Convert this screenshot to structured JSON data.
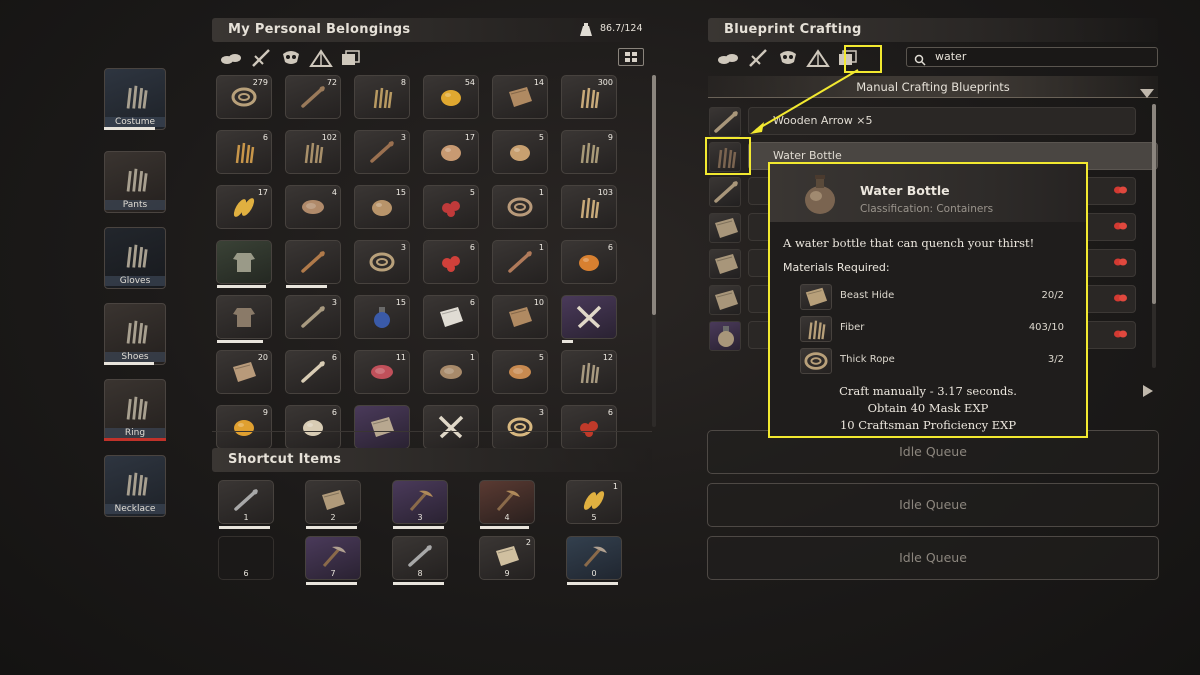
{
  "equipment": [
    {
      "label": "Costume",
      "icon": "costume-icon",
      "durability": 0.82,
      "dur_color": "#e8e4dc"
    },
    {
      "label": "Pants",
      "icon": "pants-icon",
      "durability": 0,
      "dur_color": "#e8e4dc"
    },
    {
      "label": "Gloves",
      "icon": "gloves-icon",
      "durability": 0,
      "dur_color": "#e8e4dc"
    },
    {
      "label": "Shoes",
      "icon": "shoes-icon",
      "durability": 0.8,
      "dur_color": "#e8e4dc"
    },
    {
      "label": "Ring",
      "icon": "ring-icon",
      "durability": 1.0,
      "dur_color": "#c0322a"
    },
    {
      "label": "Necklace",
      "icon": "necklace-icon",
      "durability": 0,
      "dur_color": "#e8e4dc"
    }
  ],
  "inventory": {
    "title": "My Personal Belongings",
    "weight": "86.7/124",
    "weight_icon": "weight-icon",
    "filter_icons": [
      "resources-icon",
      "weapons-icon",
      "armor-icon",
      "camp-icon",
      "all-items-icon"
    ],
    "layout_icon": "grid-layout-icon",
    "items": [
      {
        "icon": "rope-coil-icon",
        "qty": "279",
        "tone": "",
        "color": "#b8a07a",
        "durability": null
      },
      {
        "icon": "branch-icon",
        "qty": "72",
        "tone": "",
        "color": "#9a7a5a",
        "durability": null
      },
      {
        "icon": "grass-bundle-icon",
        "qty": "8",
        "tone": "",
        "color": "#b89a62",
        "durability": null
      },
      {
        "icon": "resin-icon",
        "qty": "54",
        "tone": "",
        "color": "#e0a830",
        "durability": null
      },
      {
        "icon": "wood-plank-icon",
        "qty": "14",
        "tone": "",
        "color": "#b08a62",
        "durability": null
      },
      {
        "icon": "fiber-bundle-icon",
        "qty": "300",
        "tone": "",
        "color": "#c8aa7a",
        "durability": null
      },
      {
        "icon": "seeds-icon",
        "qty": "6",
        "tone": "",
        "color": "#c8964a",
        "durability": null
      },
      {
        "icon": "hay-bundle-icon",
        "qty": "102",
        "tone": "",
        "color": "#a8906a",
        "durability": null
      },
      {
        "icon": "spear-icon",
        "qty": "3",
        "tone": "",
        "color": "#9a7050",
        "durability": null
      },
      {
        "icon": "mushroom-icon",
        "qty": "17",
        "tone": "",
        "color": "#c89a72",
        "durability": null
      },
      {
        "icon": "potato-icon",
        "qty": "5",
        "tone": "",
        "color": "#c8a070",
        "durability": null
      },
      {
        "icon": "herb-icon",
        "qty": "9",
        "tone": "",
        "color": "#a89a78",
        "durability": null
      },
      {
        "icon": "corn-icon",
        "qty": "17",
        "tone": "",
        "color": "#e0b040",
        "durability": null
      },
      {
        "icon": "meat-jerky-icon",
        "qty": "4",
        "tone": "",
        "color": "#b08a6a",
        "durability": null
      },
      {
        "icon": "nuts-icon",
        "qty": "15",
        "tone": "",
        "color": "#b8946a",
        "durability": null
      },
      {
        "icon": "berries-icon",
        "qty": "5",
        "tone": "",
        "color": "#c03a3a",
        "durability": null
      },
      {
        "icon": "clay-disc-icon",
        "qty": "1",
        "tone": "",
        "color": "#b89a7a",
        "durability": null
      },
      {
        "icon": "fiber-bundle-icon",
        "qty": "103",
        "tone": "",
        "color": "#c8aa7a",
        "durability": null
      },
      {
        "icon": "cloth-shirt-icon",
        "qty": "",
        "tone": "green",
        "color": "#9a9a88",
        "durability": 0.9
      },
      {
        "icon": "torch-icon",
        "qty": "",
        "tone": "",
        "color": "#b07a4a",
        "durability": 0.75
      },
      {
        "icon": "rope-coil-icon",
        "qty": "3",
        "tone": "",
        "color": "#b8a07a",
        "durability": null
      },
      {
        "icon": "strawberry-icon",
        "qty": "6",
        "tone": "",
        "color": "#d0403a",
        "durability": null
      },
      {
        "icon": "bone-icon",
        "qty": "1",
        "tone": "",
        "color": "#b07a5a",
        "durability": null
      },
      {
        "icon": "pumpkin-icon",
        "qty": "6",
        "tone": "",
        "color": "#d88030",
        "durability": null
      },
      {
        "icon": "leather-skirt-icon",
        "qty": "",
        "tone": "",
        "color": "#8a7a68",
        "durability": 0.85
      },
      {
        "icon": "twigs-icon",
        "qty": "3",
        "tone": "",
        "color": "#a89a80",
        "durability": null
      },
      {
        "icon": "potion-icon",
        "qty": "15",
        "tone": "",
        "color": "#3a5aa8",
        "durability": null
      },
      {
        "icon": "cloth-roll-icon",
        "qty": "6",
        "tone": "",
        "color": "#e0dcd4",
        "durability": null
      },
      {
        "icon": "wood-plank-icon",
        "qty": "10",
        "tone": "",
        "color": "#b08a62",
        "durability": null
      },
      {
        "icon": "crossed-tusks-icon",
        "qty": "",
        "tone": "purple",
        "color": "#e0d8c8",
        "durability": 0.2
      },
      {
        "icon": "hide-icon",
        "qty": "20",
        "tone": "",
        "color": "#b89a7a",
        "durability": null
      },
      {
        "icon": "bone-icon",
        "qty": "6",
        "tone": "",
        "color": "#d8ccb4",
        "durability": null
      },
      {
        "icon": "raw-meat-icon",
        "qty": "11",
        "tone": "",
        "color": "#c0505a",
        "durability": null
      },
      {
        "icon": "fish-icon",
        "qty": "1",
        "tone": "",
        "color": "#a88a6a",
        "durability": null
      },
      {
        "icon": "drumstick-icon",
        "qty": "5",
        "tone": "",
        "color": "#c88a50",
        "durability": null
      },
      {
        "icon": "feathers-icon",
        "qty": "12",
        "tone": "",
        "color": "#a89a80",
        "durability": null
      },
      {
        "icon": "fruit-icon",
        "qty": "9",
        "tone": "",
        "color": "#e0a030",
        "durability": null
      },
      {
        "icon": "egg-icon",
        "qty": "6",
        "tone": "",
        "color": "#d8ccb4",
        "durability": null
      },
      {
        "icon": "wrap-icon",
        "qty": "",
        "tone": "purple",
        "color": "#b8a890",
        "durability": null
      },
      {
        "icon": "crossed-tusks-icon",
        "qty": "",
        "tone": "",
        "color": "#e0d8c8",
        "durability": null
      },
      {
        "icon": "bowl-icon",
        "qty": "3",
        "tone": "",
        "color": "#d8b880",
        "durability": null
      },
      {
        "icon": "crab-icon",
        "qty": "6",
        "tone": "",
        "color": "#c03a2a",
        "durability": null
      }
    ]
  },
  "shortcut": {
    "title": "Shortcut Items",
    "slots": [
      {
        "num": "1",
        "qty": "",
        "icon": "knife-icon",
        "tone": "",
        "color": "#a8a8a8",
        "durability": 0.95
      },
      {
        "num": "2",
        "qty": "",
        "icon": "skin-icon",
        "tone": "",
        "color": "#b09a7a",
        "durability": 0.95
      },
      {
        "num": "3",
        "qty": "",
        "icon": "bow-icon",
        "tone": "purple",
        "color": "#b08a5a",
        "durability": 0.95
      },
      {
        "num": "4",
        "qty": "",
        "icon": "pickaxe-icon",
        "tone": "red",
        "color": "#b08a5a",
        "durability": 0.9
      },
      {
        "num": "5",
        "qty": "1",
        "icon": "corn-icon",
        "tone": "",
        "color": "#e0b040",
        "durability": null
      },
      {
        "num": "6",
        "qty": "",
        "icon": "",
        "tone": "empty",
        "color": "#555",
        "durability": null
      },
      {
        "num": "7",
        "qty": "",
        "icon": "axe-icon",
        "tone": "purple",
        "color": "#b0a090",
        "durability": 0.95
      },
      {
        "num": "8",
        "qty": "",
        "icon": "blade-icon",
        "tone": "",
        "color": "#a8a8a8",
        "durability": 0.95
      },
      {
        "num": "9",
        "qty": "2",
        "icon": "map-icon",
        "tone": "",
        "color": "#d0c0a0",
        "durability": null
      },
      {
        "num": "0",
        "qty": "",
        "icon": "crossbow-icon",
        "tone": "blue",
        "color": "#b0a090",
        "durability": 0.95
      }
    ]
  },
  "crafting": {
    "title": "Blueprint Crafting",
    "filter_icons": [
      "resources-icon",
      "weapons-icon",
      "armor-icon",
      "camp-icon",
      "all-blueprints-icon"
    ],
    "search_value": "water",
    "search_icon": "search-icon",
    "section": "Manual Crafting Blueprints",
    "blueprints": [
      {
        "label": "Wooden Arrow ×5",
        "icon": "arrow-icon",
        "tone": "",
        "selected": false
      },
      {
        "label": "Water Bottle",
        "icon": "water-bottle-icon",
        "tone": "",
        "selected": true
      },
      {
        "label": "",
        "icon": "arrow-icon",
        "tone": "",
        "selected": false
      },
      {
        "label": "",
        "icon": "scroll-icon",
        "tone": "",
        "selected": false
      },
      {
        "label": "",
        "icon": "scroll-icon",
        "tone": "",
        "selected": false
      },
      {
        "label": "",
        "icon": "scroll-icon",
        "tone": "",
        "selected": false
      },
      {
        "label": "",
        "icon": "potion-icon",
        "tone": "purple",
        "selected": false
      }
    ],
    "queues": [
      "Idle Queue",
      "Idle Queue",
      "Idle Queue"
    ]
  },
  "tooltip": {
    "title": "Water Bottle",
    "classification": "Classification: Containers",
    "description": "A water bottle that can quench your thirst!",
    "materials_header": "Materials Required:",
    "materials": [
      {
        "name": "Beast Hide",
        "count": "20/2",
        "icon": "hide-icon"
      },
      {
        "name": "Fiber",
        "count": "403/10",
        "icon": "fiber-icon"
      },
      {
        "name": "Thick Rope",
        "count": "3/2",
        "icon": "rope-coil-icon"
      }
    ],
    "footer": [
      "Craft manually - 3.17 seconds.",
      "Obtain 40 Mask EXP",
      "10 Craftsman Proficiency EXP"
    ]
  },
  "colors": {
    "highlight": "#f2e930",
    "accent_red": "#c0322a"
  }
}
